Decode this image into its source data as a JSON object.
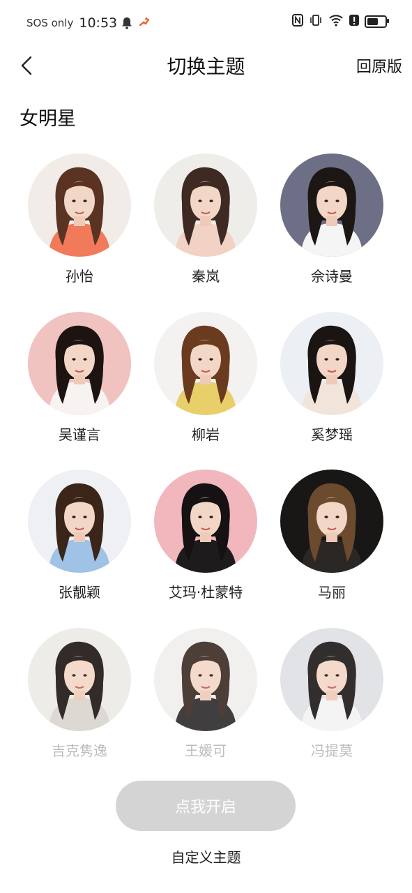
{
  "status_bar": {
    "carrier": "SOS only",
    "time": "10:53",
    "battery_level": 0.7
  },
  "header": {
    "title": "切换主题",
    "restore_label": "回原版"
  },
  "section": {
    "title": "女明星"
  },
  "celebrities": [
    {
      "name": "孙怡",
      "bg": "#f1ece8",
      "hair": "#5a3322",
      "top": "#f07a5a",
      "faded": false
    },
    {
      "name": "秦岚",
      "bg": "#efedea",
      "hair": "#3e2a22",
      "top": "#f2d2c4",
      "faded": false
    },
    {
      "name": "佘诗曼",
      "bg": "#6d6f86",
      "hair": "#1c1714",
      "top": "#f5f5f5",
      "faded": false
    },
    {
      "name": "吴谨言",
      "bg": "#f0c2c0",
      "hair": "#1d1411",
      "top": "#f6f3f0",
      "faded": false
    },
    {
      "name": "柳岩",
      "bg": "#f3f2f1",
      "hair": "#6b3b20",
      "top": "#e8cf6a",
      "faded": false
    },
    {
      "name": "奚梦瑶",
      "bg": "#eceff3",
      "hair": "#1a1412",
      "top": "#f1e4da",
      "faded": false
    },
    {
      "name": "张靓颖",
      "bg": "#eef0f3",
      "hair": "#3b2519",
      "top": "#9fc2e6",
      "faded": false
    },
    {
      "name": "艾玛·杜蒙特",
      "bg": "#f1b7bd",
      "hair": "#161112",
      "top": "#1e1b1c",
      "faded": false
    },
    {
      "name": "马丽",
      "bg": "#181716",
      "hair": "#6b4a2e",
      "top": "#2a2725",
      "faded": false
    },
    {
      "name": "吉克隽逸",
      "bg": "#ecebe7",
      "hair": "#1c1511",
      "top": "#d9d5ce",
      "faded": true
    },
    {
      "name": "王媛可",
      "bg": "#f0efed",
      "hair": "#3a2a22",
      "top": "#2c2a2a",
      "faded": true
    },
    {
      "name": "冯提莫",
      "bg": "#dfe0e5",
      "hair": "#1c1818",
      "top": "#f4f3f3",
      "faded": true
    }
  ],
  "actions": {
    "open_label": "点我开启",
    "custom_label": "自定义主题"
  }
}
